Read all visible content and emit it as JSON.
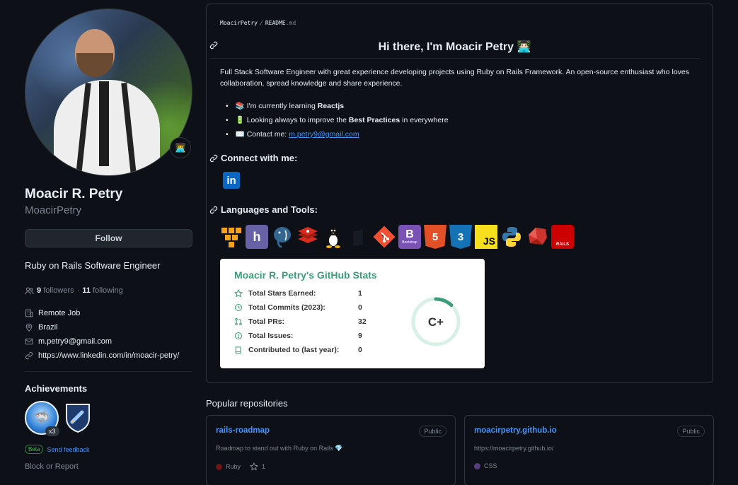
{
  "profile": {
    "name": "Moacir R. Petry",
    "login": "MoacirPetry",
    "follow_label": "Follow",
    "bio": "Ruby on Rails Software Engineer",
    "followers_count": "9",
    "followers_label": "followers",
    "following_count": "11",
    "following_label": "following",
    "separator": "·",
    "status_emoji": "👨‍💻",
    "details": {
      "company": "Remote Job",
      "location": "Brazil",
      "email": "m.petry9@gmail.com",
      "website": "https://www.linkedin.com/in/moacir-petry/"
    },
    "achievements_title": "Achievements",
    "achievement_multiplier": "x3",
    "beta_label": "Beta",
    "send_feedback": "Send feedback",
    "block_report": "Block or Report"
  },
  "readme": {
    "breadcrumb_owner": "MoacirPetry",
    "breadcrumb_sep": "/",
    "breadcrumb_file": "README",
    "breadcrumb_ext": ".md",
    "heading": "Hi there, I'm Moacir Petry 👨🏻‍💻",
    "intro": "Full Stack Software Engineer with great experience developing projects using Ruby on Rails Framework. An open-source enthusiast who loves collaboration, spread knowledge and share experience.",
    "bullets": {
      "learning_emoji": "📚",
      "learning_prefix": "I'm currently learning ",
      "learning_bold": "Reactjs",
      "improve_emoji": "🔋",
      "improve_prefix": "Looking always to improve the ",
      "improve_bold": "Best Practices",
      "improve_suffix": " in everywhere",
      "contact_emoji": "✉️",
      "contact_prefix": "Contact me: ",
      "contact_link": "m.petry9@gmail.com"
    },
    "connect_heading": "Connect with me:",
    "linkedin_label": "in",
    "languages_heading": "Languages and Tools:",
    "tools": [
      "AWS",
      "Heroku",
      "PostgreSQL",
      "Redis",
      "Linux",
      "Git",
      "Bootstrap",
      "HTML5",
      "CSS3",
      "JS",
      "Python",
      "Ruby",
      "Rails"
    ],
    "tool_glyphs": {
      "heroku": "h",
      "bootstrap": "B",
      "bootstrap_sub": "Bootstrap",
      "html5": "5",
      "css3": "3",
      "js": "JS",
      "rails": "RAILS"
    },
    "stats": {
      "title": "Moacir R. Petry's GitHub Stats",
      "rows": [
        {
          "label": "Total Stars Earned:",
          "value": "1"
        },
        {
          "label": "Total Commits (2023):",
          "value": "0"
        },
        {
          "label": "Total PRs:",
          "value": "32"
        },
        {
          "label": "Total Issues:",
          "value": "9"
        },
        {
          "label": "Contributed to (last year):",
          "value": "0"
        }
      ],
      "rank": "C+",
      "rank_progress": 0.12
    }
  },
  "popular": {
    "title": "Popular repositories",
    "repos": [
      {
        "name": "rails-roadmap",
        "visibility": "Public",
        "description": "Roadmap to stand out with Ruby on Rails 💎",
        "language": "Ruby",
        "language_color": "#701516",
        "stars": "1"
      },
      {
        "name": "moacirpetry.github.io",
        "visibility": "Public",
        "description": "https://moacirpetry.github.io/",
        "language": "CSS",
        "language_color": "#563d7c"
      }
    ]
  },
  "colors": {
    "background": "#0d1117",
    "link": "#4493f8",
    "muted": "#7d8590",
    "stats_accent": "#3a9f79"
  }
}
